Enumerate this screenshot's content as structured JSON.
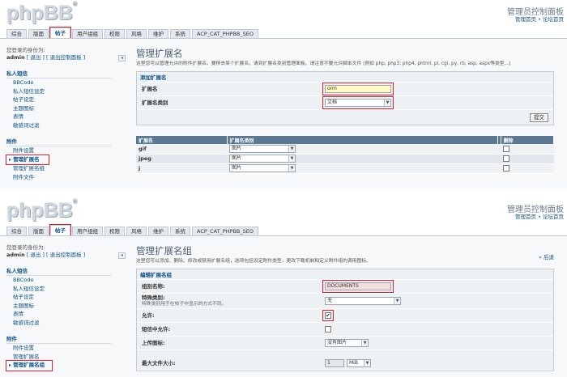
{
  "header": {
    "logo": "phpBB",
    "logo_mark": "®",
    "acp_title": "管理员控制面板",
    "acp_links": "管理首页 • 论坛首页"
  },
  "tabs": [
    {
      "label": "综合"
    },
    {
      "label": "版面"
    },
    {
      "label": "帖子"
    },
    {
      "label": "用户组组"
    },
    {
      "label": "权限"
    },
    {
      "label": "风格"
    },
    {
      "label": "维护"
    },
    {
      "label": "系统"
    },
    {
      "label": "ACP_CAT_PHPBB_SEO"
    }
  ],
  "sidebar": {
    "who_line": "您登录的身份为:",
    "user": "admin",
    "logout": "[ 退出 ]",
    "exit_acp": "[ 退出控制面板 ]",
    "collapse": "◂",
    "sections": [
      {
        "title": "私人短信",
        "items": [
          "BBCode",
          "私人短信设定",
          "帖子设定",
          "主题图标",
          "表情",
          "敏感词过滤"
        ]
      },
      {
        "title": "附件",
        "items": [
          "附件设置",
          "管理扩展名",
          "管理扩展名组",
          "附件文件"
        ]
      }
    ]
  },
  "screen1": {
    "title": "管理扩展名",
    "desc": "这里您可以管理允许的附件扩展名。要移去某个扩展名，请到扩展名类别管理面板。请注意不要允许脚本文件 (例如 php, php3, php4, phtml, pl, cgi, py, rb, asp, aspx等类型...)",
    "legend": "添加扩展名",
    "ext_label": "扩展名",
    "ext_value": "orm",
    "group_label": "扩展名类别",
    "group_value": "文档",
    "submit": "提交",
    "table": {
      "headers": [
        "扩展名",
        "扩展名类别",
        "",
        "删除"
      ],
      "rows": [
        {
          "ext": "gif",
          "group": "图片"
        },
        {
          "ext": "jpeg",
          "group": "图片"
        },
        {
          "ext": "j",
          "group": "图片"
        }
      ]
    }
  },
  "screen2": {
    "title": "管理扩展名组",
    "desc": "这里您可以添加、删除、修改或禁用扩展名组，选项包括设定附件类型，更改下载机制和定义附件组的调用图标。",
    "back": "« 后退",
    "legend": "编辑扩展名组",
    "group_name_label": "组别名称:",
    "group_name_value": "DOCUMENTS",
    "special_label": "特殊类别:",
    "special_sub": "特殊类别用于在帖子中显示的方式不同。",
    "special_value": "无",
    "allowed_label": "允许:",
    "allowed_checked": "✔",
    "pm_label": "短信中允许:",
    "icon_label": "上传图标:",
    "icon_value": "没有图片",
    "maxsize_label": "最大文件大小:",
    "maxsize_value": "1",
    "maxsize_unit": "MiB"
  }
}
